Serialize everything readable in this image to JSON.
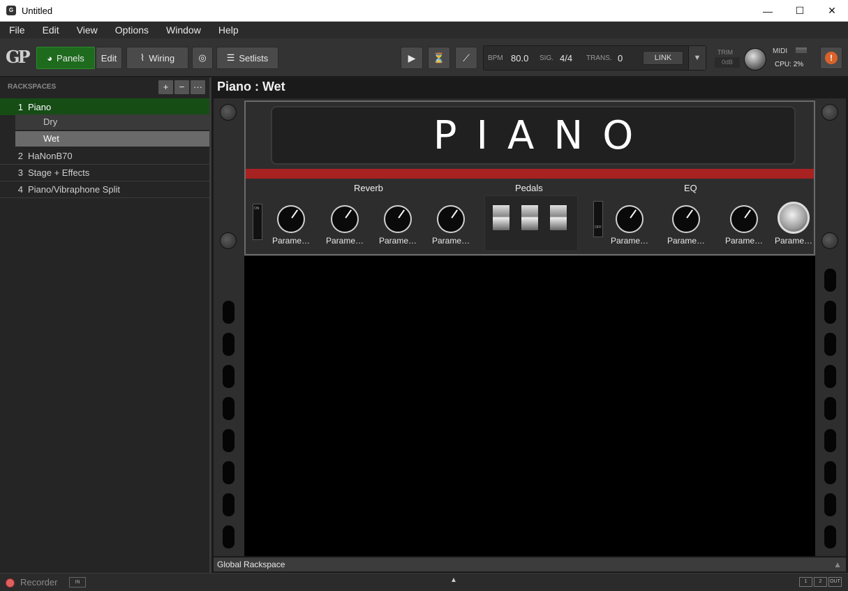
{
  "window": {
    "title": "Untitled",
    "controls": [
      "—",
      "☐",
      "✕"
    ]
  },
  "menu": [
    "File",
    "Edit",
    "View",
    "Options",
    "Window",
    "Help"
  ],
  "toolbar": {
    "logo": "GP",
    "panels_label": "Panels",
    "edit_label": "Edit",
    "wiring_label": "Wiring",
    "setlists_label": "Setlists",
    "bpm_label": "BPM",
    "bpm_value": "80.0",
    "sig_label": "SIG.",
    "sig_value": "4/4",
    "trans_label": "TRANS.",
    "trans_value": "0",
    "link_label": "LINK",
    "trim_label": "TRIM",
    "trim_value": "0dB",
    "midi_label": "MIDI",
    "cpu_label": "CPU:",
    "cpu_value": "2%"
  },
  "sidebar": {
    "header": "RACKSPACES",
    "tools": [
      "+",
      "−",
      "···"
    ],
    "rackspaces": [
      {
        "num": "1",
        "name": "Piano",
        "selected": true
      },
      {
        "num": "2",
        "name": "HaNonB70"
      },
      {
        "num": "3",
        "name": "Stage + Effects"
      },
      {
        "num": "4",
        "name": "Piano/Vibraphone Split"
      }
    ],
    "variations": [
      {
        "name": "Dry"
      },
      {
        "name": "Wet",
        "selected": true
      }
    ]
  },
  "main": {
    "title": "Piano : Wet",
    "panel_name": "PIANO",
    "sections": {
      "reverb": "Reverb",
      "pedals": "Pedals",
      "eq": "EQ"
    },
    "param_label": "Parame…",
    "switch_on": "ON",
    "switch_off": "OFF"
  },
  "global_bar": {
    "label": "Global Rackspace",
    "arrow": "▲"
  },
  "statusbar": {
    "recorder": "Recorder",
    "in": "IN",
    "center_arrow": "▲",
    "out_buttons": [
      "1",
      "2",
      "OUT"
    ]
  },
  "colors": {
    "accent_green": "#1e6b1e",
    "stripe_red": "#a82222",
    "record_red": "#e06060"
  }
}
